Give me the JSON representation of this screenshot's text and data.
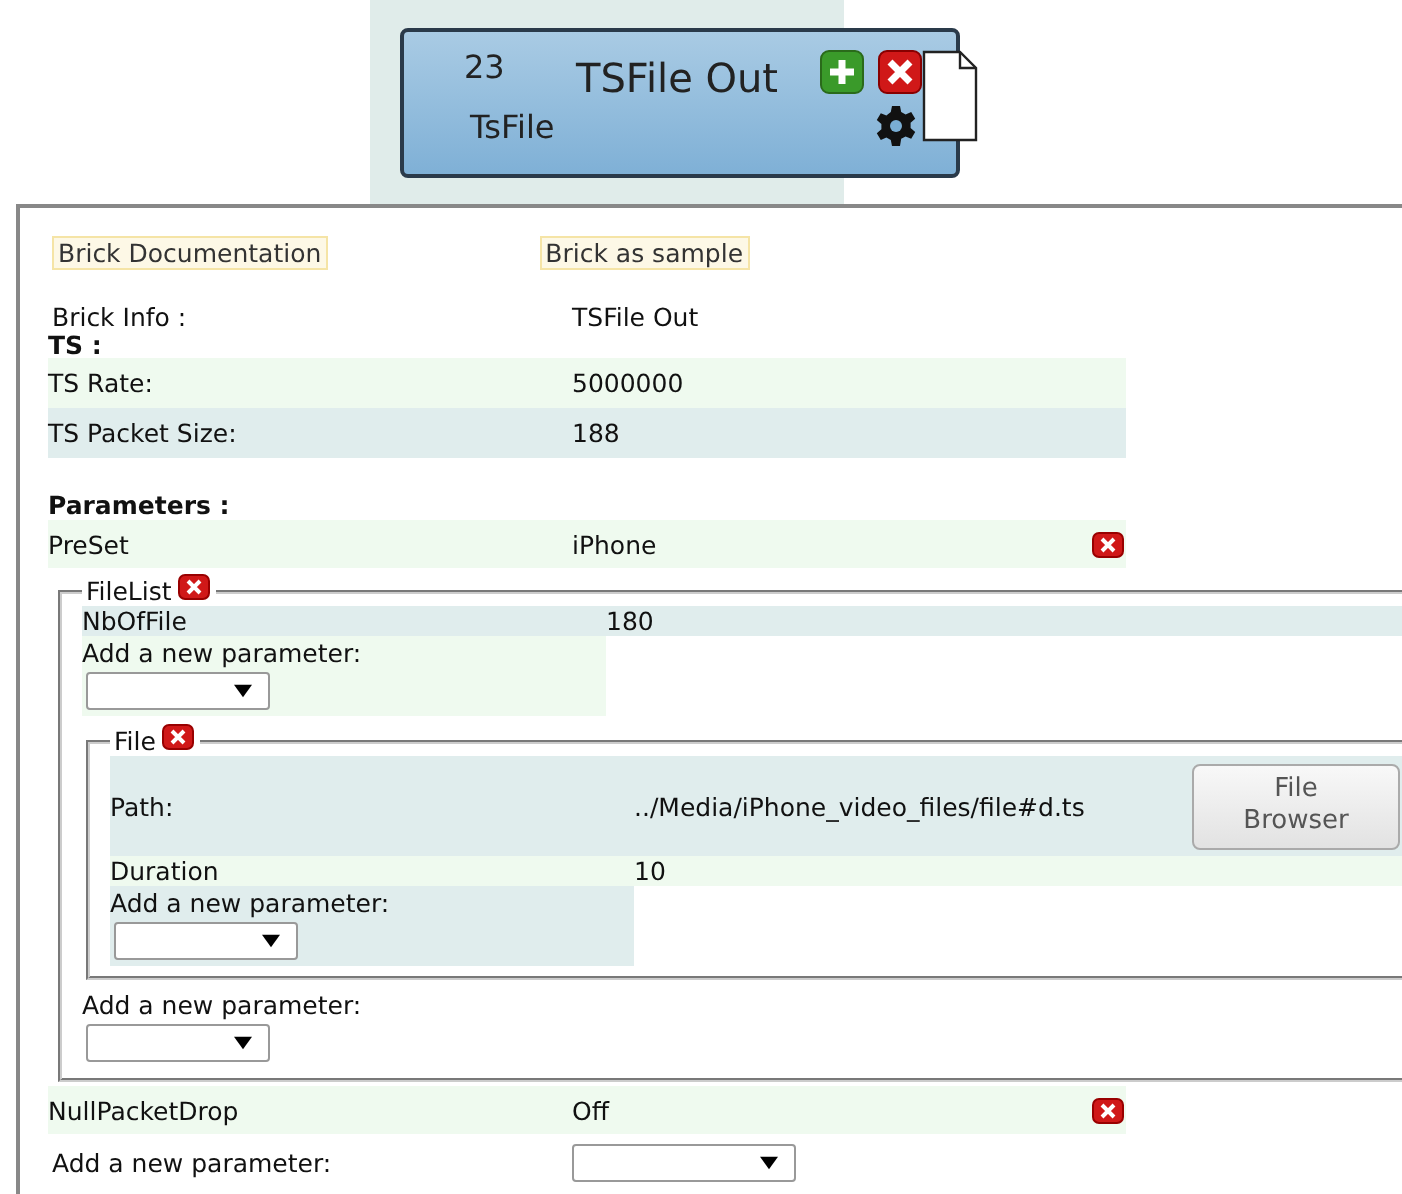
{
  "brick_node": {
    "number": "23",
    "title": "TSFile Out",
    "type": "TsFile"
  },
  "links": [
    "Brick Documentation",
    "Brick as sample"
  ],
  "brick_info": {
    "label": "Brick Info :",
    "value": "TSFile Out"
  },
  "ts": {
    "heading": "TS :",
    "rows": [
      {
        "label": "TS Rate:",
        "value": "5000000",
        "color": "#effaef"
      },
      {
        "label": "TS Packet Size:",
        "value": "188",
        "color": "#e0eded"
      }
    ]
  },
  "parameters": {
    "heading": "Parameters :",
    "items": [
      {
        "kind": "param",
        "label": "PreSet",
        "value": "iPhone",
        "color": "#effaef",
        "removable": true
      },
      {
        "kind": "group",
        "label": "FileList",
        "removable": true,
        "children": [
          {
            "kind": "param",
            "label": "NbOfFile",
            "value": "180",
            "color": "#e0eded"
          },
          {
            "kind": "add",
            "label": "Add a new parameter:",
            "color": "#effaef"
          },
          {
            "kind": "group",
            "label": "File",
            "removable": true,
            "children": [
              {
                "kind": "param",
                "label": "Path:",
                "value": "../Media/iPhone_video_files/file#d.ts",
                "button": "File Browser",
                "color": "#e0eded"
              },
              {
                "kind": "param",
                "label": "Duration",
                "value": "10",
                "color": "#effaef"
              },
              {
                "kind": "add",
                "label": "Add a new parameter:",
                "color": "#e0eded"
              }
            ]
          },
          {
            "kind": "add",
            "label": "Add a new parameter:"
          }
        ]
      },
      {
        "kind": "param",
        "label": "NullPacketDrop",
        "value": "Off",
        "color": "#effaef",
        "removable": true
      }
    ],
    "add_label": "Add a new parameter:"
  }
}
